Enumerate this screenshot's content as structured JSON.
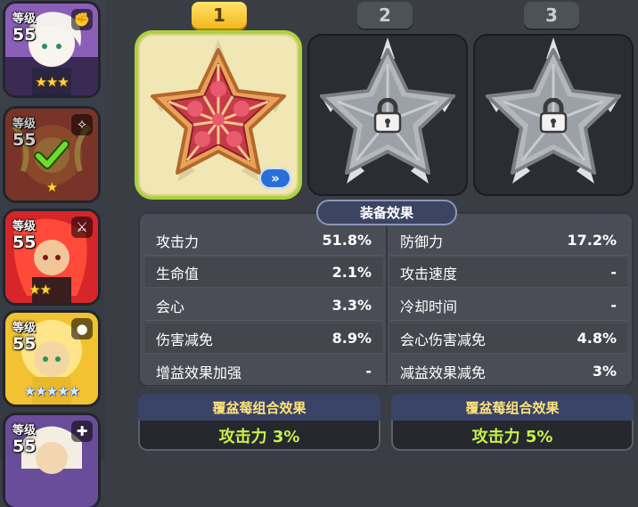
{
  "characters": [
    {
      "level_label": "等级",
      "level": "55",
      "stars": "★★★",
      "star_style": "gold",
      "type_icon": "fist-icon",
      "type_glyph": "✊",
      "selected": false
    },
    {
      "level_label": "等级",
      "level": "55",
      "stars": "★",
      "star_style": "gold",
      "type_icon": "swap-icon",
      "type_glyph": "✧",
      "selected": true
    },
    {
      "level_label": "等级",
      "level": "55",
      "stars": "★★",
      "star_style": "gold",
      "type_icon": "sword-icon",
      "type_glyph": "⚔",
      "selected": false
    },
    {
      "level_label": "等级",
      "level": "55",
      "stars": "★★★★★",
      "star_style": "blue",
      "type_icon": "bomb-icon",
      "type_glyph": "●",
      "selected": false
    },
    {
      "level_label": "等级",
      "level": "55",
      "stars": "",
      "star_style": "gold",
      "type_icon": "heal-icon",
      "type_glyph": "✚",
      "selected": false
    }
  ],
  "tabs": [
    {
      "label": "1",
      "active": true
    },
    {
      "label": "2",
      "active": false
    },
    {
      "label": "3",
      "active": false
    }
  ],
  "effects": {
    "title": "装备效果",
    "left": [
      {
        "name": "攻击力",
        "value": "51.8%"
      },
      {
        "name": "生命值",
        "value": "2.1%"
      },
      {
        "name": "会心",
        "value": "3.3%"
      },
      {
        "name": "伤害减免",
        "value": "8.9%"
      },
      {
        "name": "增益效果加强",
        "value": "-"
      }
    ],
    "right": [
      {
        "name": "防御力",
        "value": "17.2%"
      },
      {
        "name": "攻击速度",
        "value": "-"
      },
      {
        "name": "冷却时间",
        "value": "-"
      },
      {
        "name": "会心伤害减免",
        "value": "4.8%"
      },
      {
        "name": "减益效果减免",
        "value": "3%"
      }
    ]
  },
  "combos": [
    {
      "title": "覆盆莓组合效果",
      "effect": "攻击力 3%"
    },
    {
      "title": "覆盆莓组合效果",
      "effect": "攻击力 5%"
    }
  ],
  "colors": {
    "active_tab": "#f2b71c",
    "active_slot_border": "#a9d43a",
    "combo_title": "#ffe27a",
    "combo_value": "#c8f04a"
  }
}
